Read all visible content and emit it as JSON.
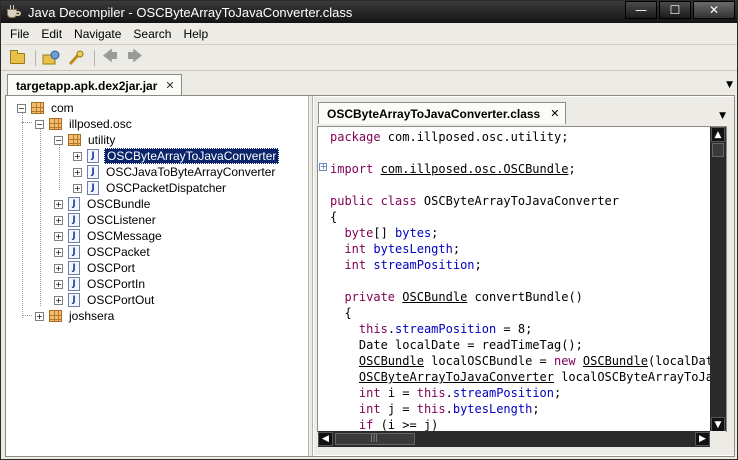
{
  "window": {
    "title": "Java Decompiler - OSCByteArrayToJavaConverter.class",
    "minimize": "—",
    "maximize": "☐",
    "close": "✕"
  },
  "menu": [
    "File",
    "Edit",
    "Navigate",
    "Search",
    "Help"
  ],
  "toolbar": {
    "icons": [
      "open-file-icon",
      "open-type-icon",
      "search-icon",
      "back-icon",
      "forward-icon"
    ]
  },
  "outer_tab": {
    "label": "targetapp.apk.dex2jar.jar",
    "close": "✕",
    "dropdown": "▼"
  },
  "tree": {
    "nodes": [
      {
        "label": "com",
        "type": "package",
        "expander": "−"
      },
      {
        "label": "illposed.osc",
        "type": "package",
        "expander": "−"
      },
      {
        "label": "utility",
        "type": "package",
        "expander": "−"
      },
      {
        "label": "OSCByteArrayToJavaConverter",
        "type": "class",
        "expander": "+",
        "selected": true
      },
      {
        "label": "OSCJavaToByteArrayConverter",
        "type": "class",
        "expander": "+"
      },
      {
        "label": "OSCPacketDispatcher",
        "type": "class",
        "expander": "+"
      },
      {
        "label": "OSCBundle",
        "type": "class",
        "expander": "+"
      },
      {
        "label": "OSCListener",
        "type": "class",
        "expander": "+"
      },
      {
        "label": "OSCMessage",
        "type": "class",
        "expander": "+"
      },
      {
        "label": "OSCPacket",
        "type": "class",
        "expander": "+"
      },
      {
        "label": "OSCPort",
        "type": "class",
        "expander": "+"
      },
      {
        "label": "OSCPortIn",
        "type": "class",
        "expander": "+"
      },
      {
        "label": "OSCPortOut",
        "type": "class",
        "expander": "+"
      },
      {
        "label": "joshsera",
        "type": "package",
        "expander": "+"
      }
    ]
  },
  "editor_tab": {
    "label": "OSCByteArrayToJavaConverter.class",
    "close": "✕",
    "dropdown": "▼"
  },
  "code": {
    "fold_marker": "+",
    "lines": [
      "package com.illposed.osc.utility;",
      "",
      "import com.illposed.osc.OSCBundle;",
      "",
      "public class OSCByteArrayToJavaConverter",
      "{",
      "  byte[] bytes;",
      "  int bytesLength;",
      "  int streamPosition;",
      "",
      "  private OSCBundle convertBundle()",
      "  {",
      "    this.streamPosition = 8;",
      "    Date localDate = readTimeTag();",
      "    OSCBundle localOSCBundle = new OSCBundle(localDate",
      "    OSCByteArrayToJavaConverter localOSCByteArrayToJava",
      "    int i = this.streamPosition;",
      "    int j = this.bytesLength;",
      "    if (i >= j)"
    ]
  },
  "scroll": {
    "up": "▲",
    "down": "▼",
    "left": "◀",
    "right": "▶",
    "grip": "|||"
  }
}
